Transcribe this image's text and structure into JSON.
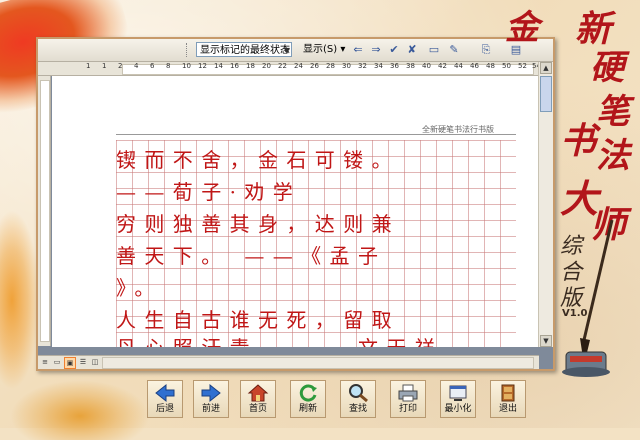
{
  "app": {
    "title_chars": [
      "金",
      "新",
      "硬",
      "笔",
      "书",
      "法",
      "大",
      "师"
    ],
    "subtitle_chars": [
      "综",
      "合",
      "版"
    ],
    "version": "V1.0"
  },
  "toolbar": {
    "markup_state": "显示标记的最终状态",
    "show_label": "显示(S)"
  },
  "ruler": {
    "labels": [
      "1",
      "1",
      "2",
      "4",
      "6",
      "8",
      "10",
      "12",
      "14",
      "16",
      "18",
      "20",
      "22",
      "24",
      "26",
      "28",
      "30",
      "32",
      "34",
      "36",
      "38",
      "40",
      "42",
      "44",
      "46",
      "48",
      "50",
      "52",
      "54"
    ],
    "visible_labels": [
      "1",
      "1",
      "2",
      "4",
      "6",
      "8",
      "10",
      "12",
      "14",
      "16",
      "18",
      "20",
      "22",
      "24",
      "26",
      "28",
      "30",
      "32",
      "34",
      "36",
      "38",
      "40",
      "42",
      "44",
      "46",
      "48",
      "50",
      "52",
      "54"
    ]
  },
  "document": {
    "header_text": "全新硬笔书法行书版",
    "lines": [
      "  锲而不舍，金石可镂。",
      "  ——荀子·劝学",
      "  穷则独善其身，达则兼",
      "善天下。  ——《孟子",
      "》。",
      "  人生自古谁无死，留取",
      "丹心照汗青。 ——文天祥"
    ]
  },
  "nav": {
    "buttons": [
      {
        "label": "后退",
        "icon": "back-arrow-icon"
      },
      {
        "label": "前进",
        "icon": "forward-arrow-icon"
      },
      {
        "label": "首页",
        "icon": "home-icon"
      },
      {
        "label": "刷新",
        "icon": "refresh-icon"
      },
      {
        "label": "查找",
        "icon": "search-icon"
      },
      {
        "label": "打印",
        "icon": "printer-icon"
      },
      {
        "label": "最小化",
        "icon": "minimize-icon"
      },
      {
        "label": "退出",
        "icon": "exit-door-icon"
      }
    ]
  },
  "colors": {
    "ink_red": "#c01616",
    "title_red": "#b2151a",
    "frame": "#c79a6a"
  }
}
